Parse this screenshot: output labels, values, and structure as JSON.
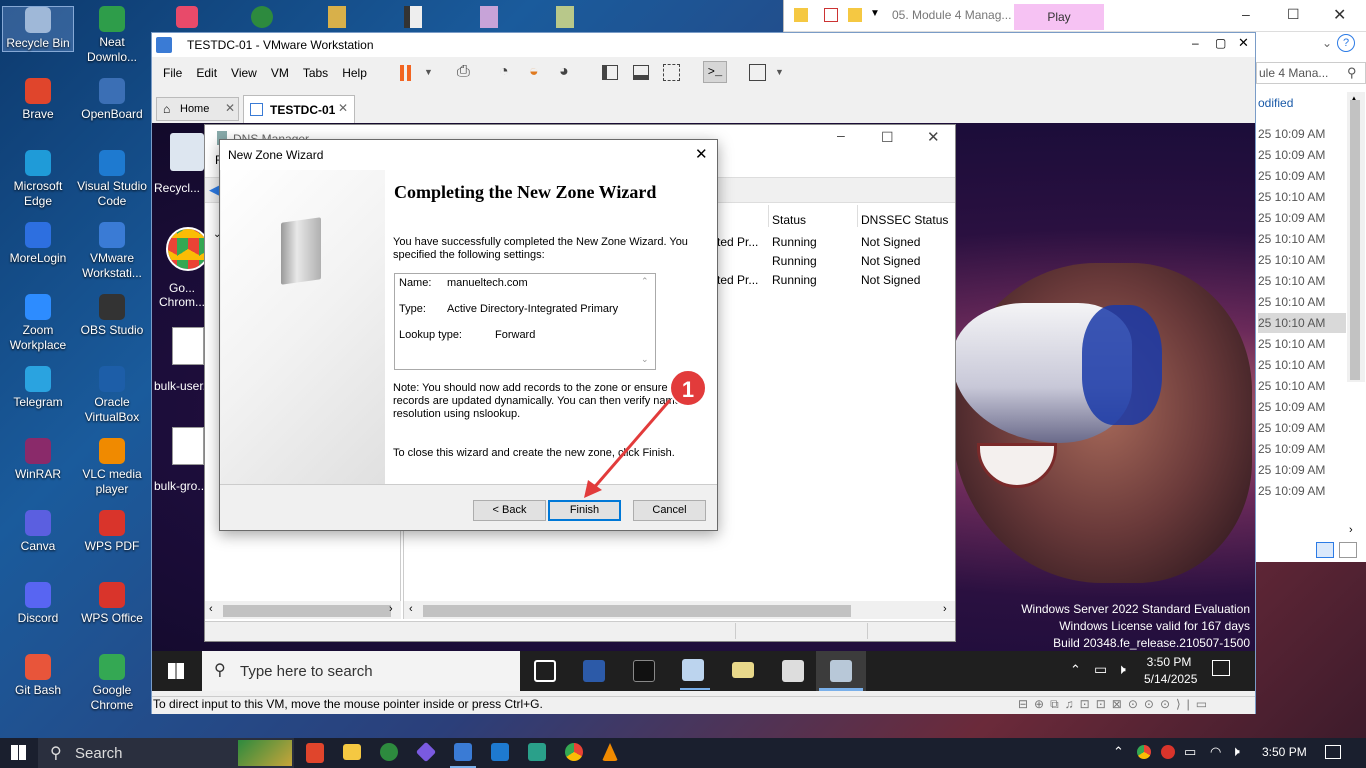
{
  "desktop": {
    "icons": [
      {
        "label": "Recycle Bin",
        "icon": "recycle-bin-icon",
        "color": "#9fb8d8"
      },
      {
        "label": "Neat Downlo...",
        "icon": "neat-download-icon",
        "color": "#2e9d4a"
      },
      {
        "label": "Brave",
        "icon": "brave-icon",
        "color": "#e0452c"
      },
      {
        "label": "OpenBoard",
        "icon": "openboard-icon",
        "color": "#3b6fb5"
      },
      {
        "label": "Microsoft Edge",
        "icon": "edge-icon",
        "color": "#1f9bd8"
      },
      {
        "label": "Visual Studio Code",
        "icon": "vscode-icon",
        "color": "#1e7ad0"
      },
      {
        "label": "MoreLogin",
        "icon": "morelogin-icon",
        "color": "#2d6fe0"
      },
      {
        "label": "VMware Workstati...",
        "icon": "vmware-icon",
        "color": "#3a7bd5"
      },
      {
        "label": "Zoom Workplace",
        "icon": "zoom-icon",
        "color": "#2d8cff"
      },
      {
        "label": "OBS Studio",
        "icon": "obs-icon",
        "color": "#333333"
      },
      {
        "label": "Telegram",
        "icon": "telegram-icon",
        "color": "#2aa3e0"
      },
      {
        "label": "Oracle VirtualBox",
        "icon": "virtualbox-icon",
        "color": "#1d5ea8"
      },
      {
        "label": "WinRAR",
        "icon": "winrar-icon",
        "color": "#8a2a6a"
      },
      {
        "label": "VLC media player",
        "icon": "vlc-icon",
        "color": "#f08a00"
      },
      {
        "label": "Canva",
        "icon": "canva-icon",
        "color": "#5b5fe0"
      },
      {
        "label": "WPS PDF",
        "icon": "wps-pdf-icon",
        "color": "#d9342b"
      },
      {
        "label": "Discord",
        "icon": "discord-icon",
        "color": "#5865f2"
      },
      {
        "label": "WPS Office",
        "icon": "wps-office-icon",
        "color": "#d9342b"
      },
      {
        "label": "Git Bash",
        "icon": "git-bash-icon",
        "color": "#e8553a"
      },
      {
        "label": "Google Chrome",
        "icon": "chrome-icon",
        "color": "#34a853"
      }
    ]
  },
  "explorer": {
    "tab_title": "05. Module 4 Manag...",
    "play_label": "Play",
    "search_placeholder": "ule 4 Mana...",
    "column_modified": "odified",
    "times": [
      "25 10:09 AM",
      "25 10:09 AM",
      "25 10:09 AM",
      "25 10:10 AM",
      "25 10:09 AM",
      "25 10:10 AM",
      "25 10:10 AM",
      "25 10:10 AM",
      "25 10:10 AM",
      "25 10:10 AM",
      "25 10:10 AM",
      "25 10:10 AM",
      "25 10:10 AM",
      "25 10:09 AM",
      "25 10:09 AM",
      "25 10:09 AM",
      "25 10:09 AM",
      "25 10:09 AM"
    ]
  },
  "vmware": {
    "title": "TESTDC-01 - VMware Workstation",
    "menu": [
      "File",
      "Edit",
      "View",
      "VM",
      "Tabs",
      "Help"
    ],
    "tabs": {
      "home": "Home",
      "vm": "TESTDC-01"
    },
    "status_bar": "To direct input to this VM, move the mouse pointer inside or press Ctrl+G."
  },
  "guest": {
    "icons": [
      "Recycl...",
      "Go... Chrom...",
      "bulk-user...",
      "bulk-gro..."
    ],
    "watermark": [
      "Windows Server 2022 Standard Evaluation",
      "Windows License valid for 167 days",
      "Build 20348.fe_release.210507-1500"
    ],
    "taskbar": {
      "search_placeholder": "Type here to search",
      "time": "3:50 PM",
      "date": "5/14/2025"
    }
  },
  "dns": {
    "title": "DNS Manager",
    "columns": [
      "Status",
      "DNSSEC Status"
    ],
    "rows": [
      {
        "type": "ted Pr...",
        "status": "Running",
        "dnssec": "Not Signed"
      },
      {
        "type": "",
        "status": "Running",
        "dnssec": "Not Signed"
      },
      {
        "type": "ted Pr...",
        "status": "Running",
        "dnssec": "Not Signed"
      }
    ]
  },
  "wizard": {
    "title": "New Zone Wizard",
    "heading": "Completing the New Zone Wizard",
    "intro": "You have successfully completed the New Zone Wizard. You specified the following settings:",
    "settings": {
      "name_label": "Name:",
      "name_value": "manueltech.com",
      "type_label": "Type:",
      "type_value": "Active Directory-Integrated Primary",
      "lookup_label": "Lookup type:",
      "lookup_value": "Forward"
    },
    "note": "Note: You should now add records to the zone or ensure that records are updated dynamically. You can then verify name resolution using nslookup.",
    "close_text": "To close this wizard and create the new zone, click Finish.",
    "back_label": "< Back",
    "finish_label": "Finish",
    "cancel_label": "Cancel",
    "annotation": "1"
  },
  "host_taskbar": {
    "search_label": "Search",
    "time": "3:50 PM"
  }
}
